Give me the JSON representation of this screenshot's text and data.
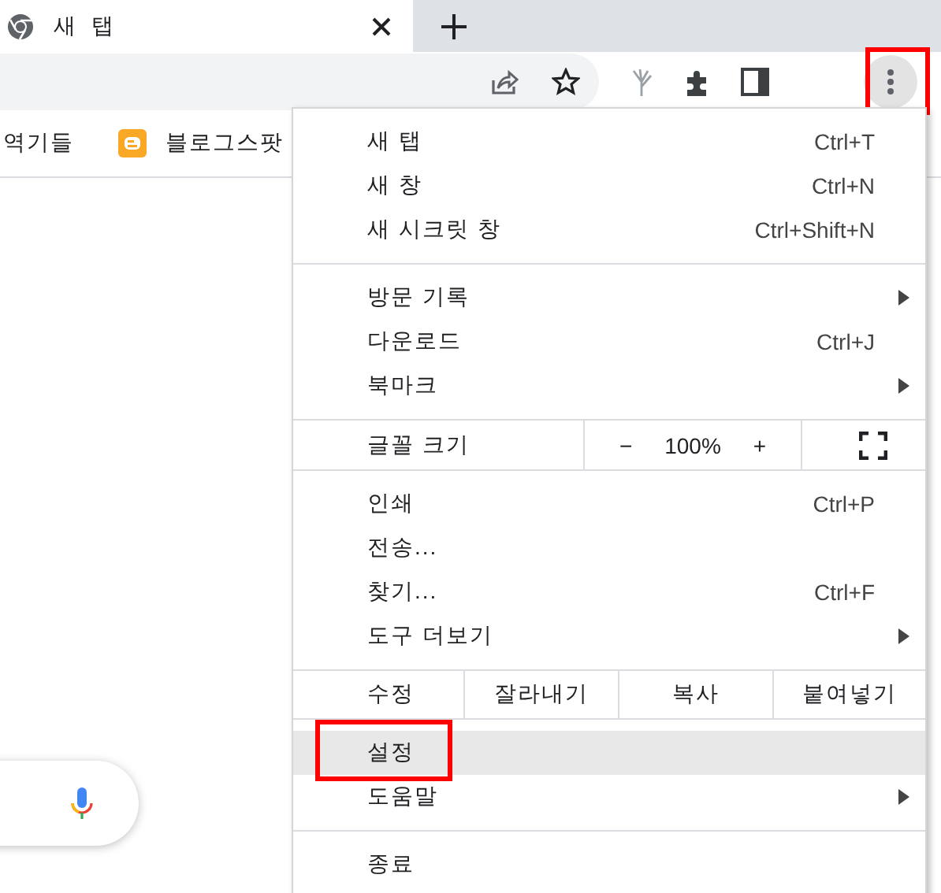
{
  "tab": {
    "title": "새 탭",
    "selected": true
  },
  "toolbar": {
    "menu_button": {
      "highlighted": true
    }
  },
  "bookmarks": [
    {
      "label": "역기들",
      "kind": "plain"
    },
    {
      "label": "블로그스팟",
      "kind": "blogger"
    }
  ],
  "menu": {
    "groups": [
      [
        {
          "kind": "command",
          "label": "새 탭",
          "shortcut": "Ctrl+T",
          "submenu": false,
          "selected": false,
          "highlighted": false
        },
        {
          "kind": "command",
          "label": "새 창",
          "shortcut": "Ctrl+N",
          "submenu": false,
          "selected": false,
          "highlighted": false
        },
        {
          "kind": "command",
          "label": "새 시크릿 창",
          "shortcut": "Ctrl+Shift+N",
          "submenu": false,
          "selected": false,
          "highlighted": false
        }
      ],
      [
        {
          "kind": "command",
          "label": "방문 기록",
          "submenu": true,
          "selected": false,
          "highlighted": false
        },
        {
          "kind": "command",
          "label": "다운로드",
          "shortcut": "Ctrl+J",
          "submenu": false,
          "selected": false,
          "highlighted": false
        },
        {
          "kind": "command",
          "label": "북마크",
          "submenu": true,
          "selected": false,
          "highlighted": false
        }
      ],
      [
        {
          "kind": "zoom",
          "label": "글꼴 크기",
          "minus": "−",
          "value": "100%",
          "plus": "+"
        }
      ],
      [
        {
          "kind": "command",
          "label": "인쇄",
          "shortcut": "Ctrl+P",
          "submenu": false,
          "selected": false,
          "highlighted": false
        },
        {
          "kind": "command",
          "label": "전송...",
          "submenu": false,
          "selected": false,
          "highlighted": false
        },
        {
          "kind": "command",
          "label": "찾기...",
          "shortcut": "Ctrl+F",
          "submenu": false,
          "selected": false,
          "highlighted": false
        },
        {
          "kind": "command",
          "label": "도구 더보기",
          "submenu": true,
          "selected": false,
          "highlighted": false
        }
      ],
      [
        {
          "kind": "edit",
          "label": "수정",
          "buttons": [
            "잘라내기",
            "복사",
            "붙여넣기"
          ]
        }
      ],
      [
        {
          "kind": "command",
          "label": "설정",
          "submenu": false,
          "selected": true,
          "highlighted": true
        },
        {
          "kind": "command",
          "label": "도움말",
          "submenu": true,
          "selected": false,
          "highlighted": false
        }
      ],
      [
        {
          "kind": "command",
          "label": "종료",
          "submenu": false,
          "selected": false,
          "highlighted": false
        }
      ]
    ]
  }
}
